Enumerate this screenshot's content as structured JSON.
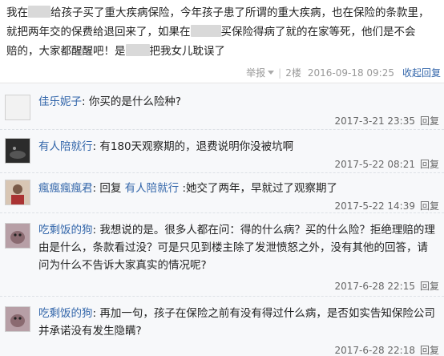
{
  "post": {
    "lines": [
      {
        "a": "我在",
        "b": "给孩子买了重大疾病保险，今年孩子患了所谓的重大疾病，也在保险的条款里，"
      },
      {
        "a": "就把两年交的保费给退回来了，如果在",
        "b": "买保险得病了就的在家等死，他们是不会"
      },
      {
        "a": "赔的，大家都醒醒吧！是",
        "b": "把我女儿耽误了"
      }
    ],
    "meta": {
      "report": "举报",
      "floor": "2楼",
      "time": "2016-09-18 09:25",
      "collapse": "收起回复"
    }
  },
  "comments": [
    {
      "user": "佳乐妮子",
      "colon": ":",
      "text": "你买的是什么险种?",
      "time": "2017-3-21 23:35",
      "reply": "回复",
      "avatar": "blank"
    },
    {
      "user": "有人陪就行",
      "colon": ":",
      "text": "有180天观察期的，退费说明你没被坑啊",
      "time": "2017-5-22 08:21",
      "reply": "回复",
      "avatar": "dark"
    },
    {
      "user": "瘋瘋瘋瘋君",
      "colon": ":",
      "prefix": "回复 ",
      "mention": "有人陪就行",
      "text": ":她交了两年，早就过了观察期了",
      "time": "2017-5-22 14:39",
      "reply": "回复",
      "avatar": "photo"
    },
    {
      "user": "吃剩饭的狗",
      "colon": ":",
      "text": "我想说的是。很多人都在问：得的什么病？买的什么险？拒绝理赔的理由是什么，条款看过没？可是只见到楼主除了发泄愤怒之外，没有其他的回答，请问为什么不告诉大家真实的情况呢?",
      "time": "2017-6-28 22:15",
      "reply": "回复",
      "avatar": "dog"
    },
    {
      "user": "吃剩饭的狗",
      "colon": ":",
      "text": "再加一句，孩子在保险之前有没有得过什么病，是否如实告知保险公司并承诺没有发生隐瞒?",
      "time": "2017-6-28 22:18",
      "reply": "回复",
      "avatar": "dog"
    }
  ]
}
